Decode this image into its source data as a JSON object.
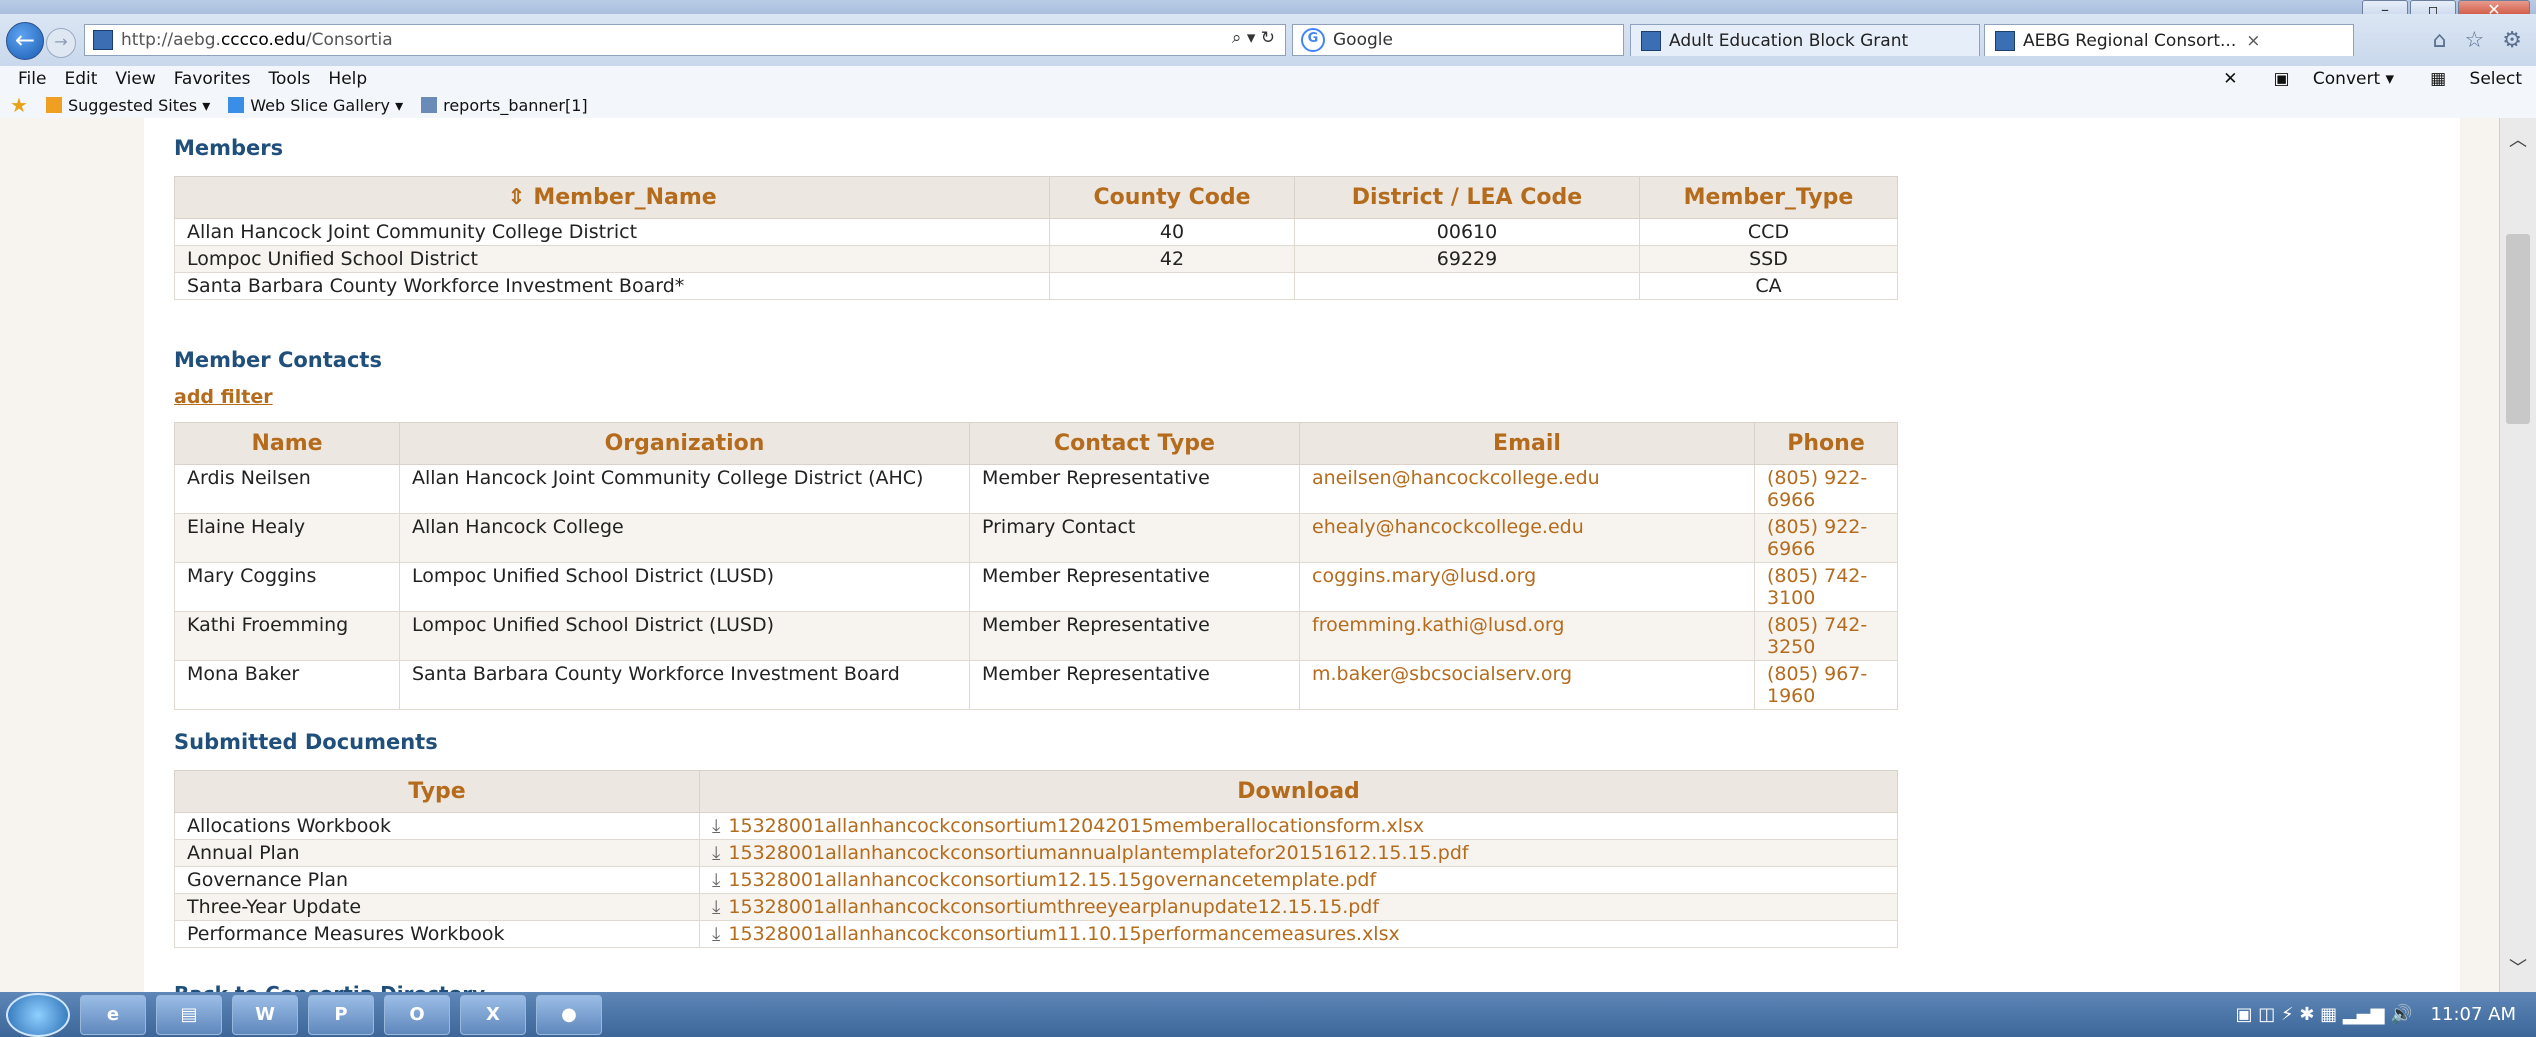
{
  "browser": {
    "url_prefix": "http://aebg.",
    "url_domain": "cccco.edu",
    "url_path": "/Consortia",
    "search_placeholder": "Google",
    "tabs": [
      {
        "label": "Adult Education Block Grant"
      },
      {
        "label": "AEBG Regional Consort...",
        "close": "×"
      }
    ],
    "menu": [
      "File",
      "Edit",
      "View",
      "Favorites",
      "Tools",
      "Help"
    ],
    "menu_right": {
      "convert": "Convert",
      "select": "Select"
    },
    "favorites": [
      {
        "label": "Suggested Sites ▾"
      },
      {
        "label": "Web Slice Gallery ▾"
      },
      {
        "label": "reports_banner[1]"
      }
    ]
  },
  "members": {
    "title": "Members",
    "columns": [
      "Member_Name",
      "County Code",
      "District / LEA Code",
      "Member_Type"
    ],
    "rows": [
      [
        "Allan Hancock Joint Community College District",
        "40",
        "00610",
        "CCD"
      ],
      [
        "Lompoc Unified School District",
        "42",
        "69229",
        "SSD"
      ],
      [
        "Santa Barbara County Workforce Investment Board*",
        "",
        "",
        "CA"
      ]
    ]
  },
  "contacts": {
    "title": "Member Contacts",
    "add_filter": "add filter",
    "columns": [
      "Name",
      "Organization",
      "Contact Type",
      "Email",
      "Phone"
    ],
    "rows": [
      [
        "Ardis Neilsen",
        "Allan Hancock Joint Community College District (AHC)",
        "Member Representative",
        "aneilsen@hancockcollege.edu",
        "(805) 922-6966"
      ],
      [
        "Elaine Healy",
        "Allan Hancock College",
        "Primary Contact",
        "ehealy@hancockcollege.edu",
        "(805) 922-6966"
      ],
      [
        "Mary Coggins",
        "Lompoc Unified School District (LUSD)",
        "Member Representative",
        "coggins.mary@lusd.org",
        "(805) 742-3100"
      ],
      [
        "Kathi Froemming",
        "Lompoc Unified School District (LUSD)",
        "Member Representative",
        "froemming.kathi@lusd.org",
        "(805) 742-3250"
      ],
      [
        "Mona Baker",
        "Santa Barbara County Workforce Investment Board",
        "Member Representative",
        "m.baker@sbcsocialserv.org",
        "(805) 967-1960"
      ]
    ]
  },
  "documents": {
    "title": "Submitted Documents",
    "columns": [
      "Type",
      "Download"
    ],
    "rows": [
      [
        "Allocations Workbook",
        "15328001allanhancockconsortium12042015memberallocationsform.xlsx"
      ],
      [
        "Annual Plan",
        "15328001allanhancockconsortiumannualplantemplatefor20151612.15.15.pdf"
      ],
      [
        "Governance Plan",
        "15328001allanhancockconsortium12.15.15governancetemplate.pdf"
      ],
      [
        "Three-Year Update",
        "15328001allanhancockconsortiumthreeyearplanupdate12.15.15.pdf"
      ],
      [
        "Performance Measures Workbook",
        "15328001allanhancockconsortium11.10.15performancemeasures.xlsx"
      ]
    ]
  },
  "back_link": "Back to Consortia Directory",
  "taskbar": {
    "apps": [
      "e",
      "▤",
      "W",
      "P",
      "O",
      "X",
      "●"
    ],
    "time": "11:07 AM"
  }
}
